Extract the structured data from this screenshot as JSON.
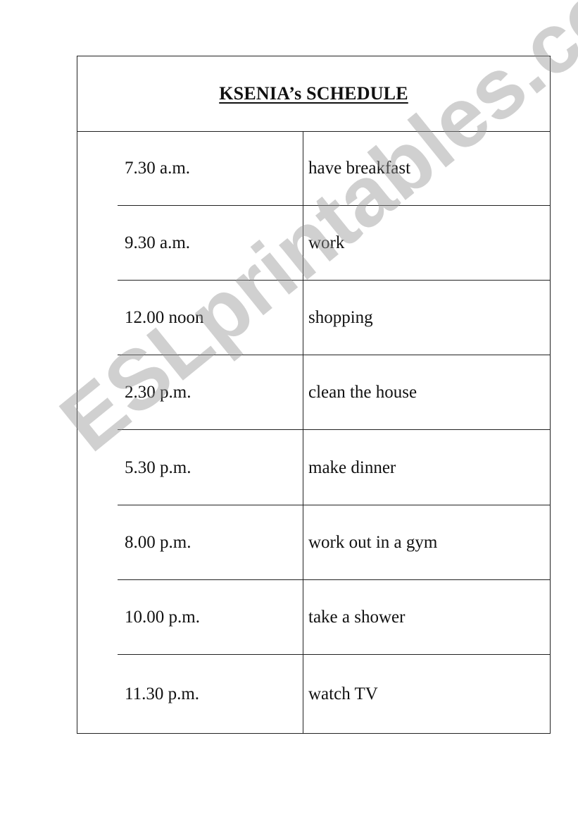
{
  "title": "KSENIA’s  SCHEDULE",
  "rows": [
    {
      "time": "7.30 a.m.",
      "activity": "have breakfast"
    },
    {
      "time": "9.30 a.m.",
      "activity": "work"
    },
    {
      "time": "12.00 noon",
      "activity": "shopping"
    },
    {
      "time": "2.30 p.m.",
      "activity": "clean the house"
    },
    {
      "time": "5.30 p.m.",
      "activity": "make dinner"
    },
    {
      "time": "8.00 p.m.",
      "activity": "work out in a gym"
    },
    {
      "time": "10.00 p.m.",
      "activity": "take a shower"
    },
    {
      "time": "11.30 p.m.",
      "activity": "watch TV"
    }
  ],
  "watermark": "ESLprintables.com"
}
